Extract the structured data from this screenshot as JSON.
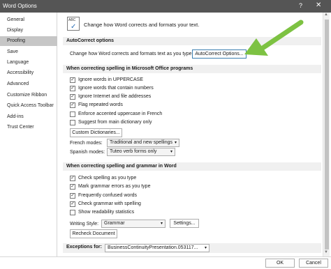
{
  "window": {
    "title": "Word Options",
    "help_glyph": "?",
    "close_glyph": "✕"
  },
  "sidebar": {
    "items": [
      {
        "label": "General"
      },
      {
        "label": "Display"
      },
      {
        "label": "Proofing",
        "active": true
      },
      {
        "label": "Save"
      },
      {
        "label": "Language"
      },
      {
        "label": "Accessibility"
      },
      {
        "label": "Advanced"
      },
      {
        "label": "Customize Ribbon"
      },
      {
        "label": "Quick Access Toolbar"
      },
      {
        "label": "Add-ins"
      },
      {
        "label": "Trust Center"
      }
    ]
  },
  "header": {
    "icon_text": "ABC",
    "intro": "Change how Word corrects and formats your text."
  },
  "autocorrect": {
    "section_title": "AutoCorrect options",
    "description": "Change how Word corrects and formats text as you type:",
    "button_label": "AutoCorrect Options..."
  },
  "office_spelling": {
    "section_title": "When correcting spelling in Microsoft Office programs",
    "checkboxes": [
      {
        "label": "Ignore words in UPPERCASE",
        "checked": true
      },
      {
        "label": "Ignore words that contain numbers",
        "checked": true
      },
      {
        "label": "Ignore Internet and file addresses",
        "checked": true
      },
      {
        "label": "Flag repeated words",
        "checked": true
      },
      {
        "label": "Enforce accented uppercase in French",
        "checked": false
      },
      {
        "label": "Suggest from main dictionary only",
        "checked": false
      }
    ],
    "custom_dictionaries_label": "Custom Dictionaries...",
    "french_modes_label": "French modes:",
    "french_modes_value": "Traditional and new spellings",
    "spanish_modes_label": "Spanish modes:",
    "spanish_modes_value": "Tuteo verb forms only"
  },
  "word_spelling": {
    "section_title": "When correcting spelling and grammar in Word",
    "checkboxes": [
      {
        "label": "Check spelling as you type",
        "checked": true
      },
      {
        "label": "Mark grammar errors as you type",
        "checked": true
      },
      {
        "label": "Frequently confused words",
        "checked": true
      },
      {
        "label": "Check grammar with spelling",
        "checked": true
      },
      {
        "label": "Show readability statistics",
        "checked": false
      }
    ],
    "writing_style_label": "Writing Style:",
    "writing_style_value": "Grammar",
    "settings_label": "Settings...",
    "recheck_label": "Recheck Document"
  },
  "exceptions": {
    "label": "Exceptions for:",
    "value": "BusinessContinuityPresentation.053117..."
  },
  "footer": {
    "ok_label": "OK",
    "cancel_label": "Cancel"
  },
  "colors": {
    "titlebar": "#555555",
    "sidebar_active": "#c6c6c6",
    "section_header": "#f0f0f0",
    "annotation_arrow": "#7dc242"
  },
  "icons": {
    "check": "✓",
    "dropdown": "▾"
  }
}
